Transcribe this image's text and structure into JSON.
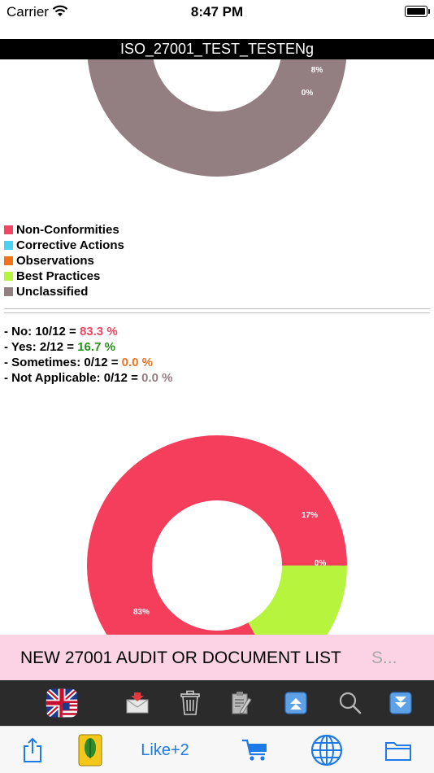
{
  "status_bar": {
    "carrier": "Carrier",
    "time": "8:47 PM"
  },
  "title": "ISO_27001_TEST_TESTENg",
  "legend": [
    {
      "label": "Non-Conformities",
      "color": "#f24662"
    },
    {
      "label": "Corrective Actions",
      "color": "#49d2f4"
    },
    {
      "label": "Observations",
      "color": "#f0731c"
    },
    {
      "label": "Best Practices",
      "color": "#b6f43d"
    },
    {
      "label": "Unclassified",
      "color": "#937e82"
    }
  ],
  "stats": [
    {
      "label": "- No: 10/12 = ",
      "value": "83.3 %",
      "color": "#f24662"
    },
    {
      "label": "- Yes: 2/12 = ",
      "value": "16.7 %",
      "color": "#2a8f1d"
    },
    {
      "label": "- Sometimes: 0/12 = ",
      "value": "0.0 %",
      "color": "#f0731c"
    },
    {
      "label": "- Not Applicable: 0/12 = ",
      "value": "0.0 %",
      "color": "#937e82"
    }
  ],
  "chart_data": [
    {
      "type": "pie",
      "labels": [
        "Non-Conformities",
        "Corrective Actions",
        "Observations",
        "Best Practices",
        "Unclassified"
      ],
      "values": [
        8,
        0,
        0,
        0,
        92
      ],
      "visible_labels": [
        "8%",
        "0%"
      ],
      "colors": [
        "#f24662",
        "#49d2f4",
        "#f0731c",
        "#b6f43d",
        "#937e82"
      ],
      "donut": true
    },
    {
      "type": "pie",
      "labels": [
        "No",
        "Yes",
        "Sometimes"
      ],
      "values": [
        83,
        17,
        0
      ],
      "visible_labels": [
        "83%",
        "17%",
        "0%"
      ],
      "colors": [
        "#f43e5c",
        "#b6f43d",
        "#f0731c"
      ],
      "donut": true
    }
  ],
  "banner": {
    "text": "NEW 27001 AUDIT OR DOCUMENT LIST",
    "more": "S..."
  },
  "toolbar": {
    "items": [
      "flag-uk-us-icon",
      "mail-download-icon",
      "trash-icon",
      "edit-note-icon",
      "scroll-top-icon",
      "search-icon",
      "scroll-bottom-icon"
    ]
  },
  "tabbar": {
    "like_label": "Like+2"
  },
  "colors": {
    "accent": "#1e7ae6",
    "title_bar": "#000000",
    "banner": "#fcd3e4",
    "toolbar": "#2b2b2b"
  }
}
